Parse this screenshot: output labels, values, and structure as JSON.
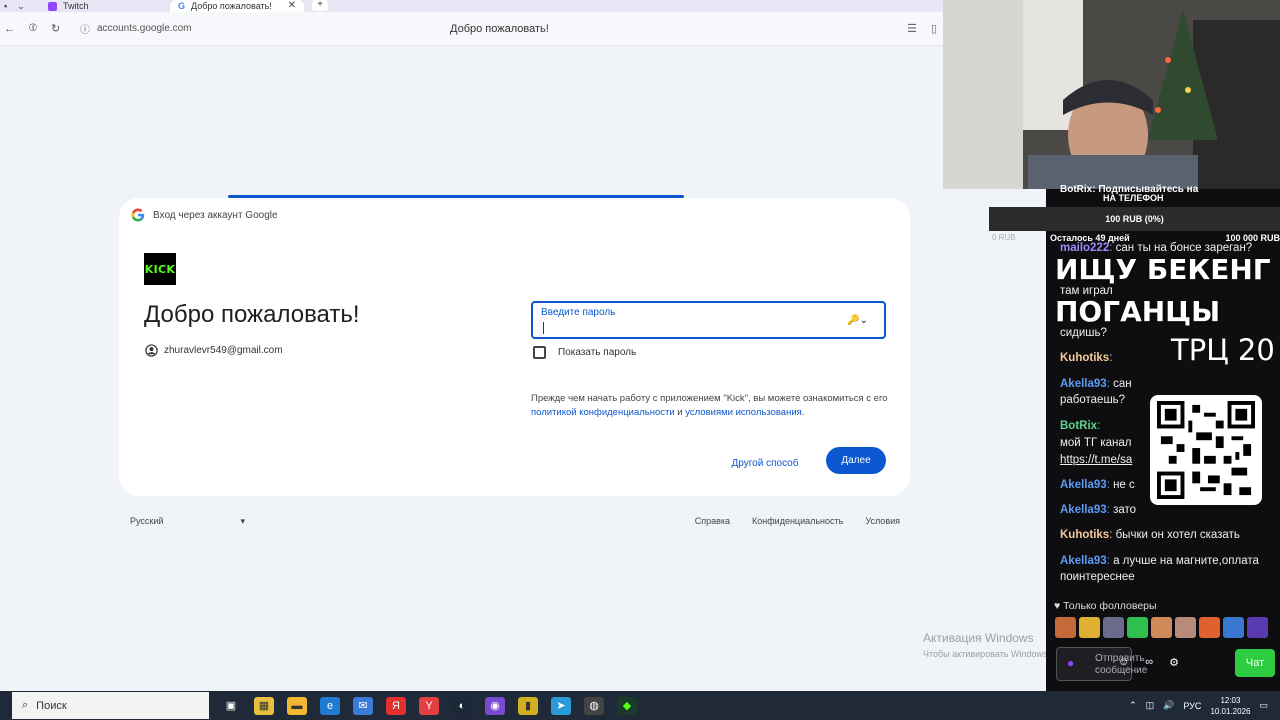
{
  "browser": {
    "tabs": [
      {
        "label": "Twitch",
        "active": false
      },
      {
        "label": "Добро пожаловать!",
        "active": true
      }
    ],
    "new_tab": "+",
    "url": "accounts.google.com",
    "page_title": "Добро пожаловать!"
  },
  "signin": {
    "header": "Вход через аккаунт Google",
    "app_logo_text": "KICK",
    "welcome": "Добро пожаловать!",
    "email": "zhuravlevr549@gmail.com",
    "password_label": "Введите пароль",
    "show_password": "Показать пароль",
    "disclaimer_prefix": "Прежде чем начать работу с приложением \"Kick\", вы можете ознакомиться с его ",
    "privacy_link": "политикой конфиденциальности",
    "conjunction": " и ",
    "terms_link": "условиями использования",
    "period": ".",
    "other_way": "Другой способ",
    "next": "Далее"
  },
  "footer": {
    "language": "Русский",
    "links": [
      "Справка",
      "Конфиденциальность",
      "Условия"
    ]
  },
  "activation": {
    "line1": "Активация Windows",
    "line2": "Чтобы активировать Windows, перейдите в раздел \"Параметры\"."
  },
  "overlay": {
    "top_text": "BotRix: Подписывайтесь на",
    "phone_text": "НА ТЕЛЕФОН",
    "donation": "100 RUB (0%)",
    "donation_left": "0 RUB",
    "donation_days": "Осталось 49 дней",
    "donation_goal": "100 000 RUB",
    "big_line1": "ИЩУ БЕКЕНГ",
    "big_line2": "ПОГАНЦЫ",
    "trc": "ТРЦ 20"
  },
  "chat": {
    "messages": [
      {
        "user": "mailo222",
        "text": "сан ты на бонсе зареган?",
        "color": "#9c8cff"
      },
      {
        "user": "",
        "text": "там играл",
        "color": "#ffffff"
      },
      {
        "user": "",
        "text": "сидишь?",
        "color": "#ffffff"
      },
      {
        "user": "Kuhotiks",
        "text": "",
        "color": "#f5c99b"
      },
      {
        "user": "Akella93",
        "text": "сан",
        "color": "#5c9cf5"
      },
      {
        "user": "",
        "text": "работаешь?",
        "color": "#ffffff"
      },
      {
        "user": "BotRix",
        "text": "",
        "color": "#5fd38d"
      },
      {
        "user": "",
        "text": "мой ТГ канал",
        "color": "#ffffff"
      },
      {
        "user": "",
        "text": "https://t.me/sa",
        "color": "#ffffff"
      },
      {
        "user": "Akella93",
        "text": "не с",
        "color": "#5c9cf5"
      },
      {
        "user": "Akella93",
        "text": "зато",
        "color": "#5c9cf5"
      },
      {
        "user": "Kuhotiks",
        "text": "бычки он хотел сказать",
        "color": "#f5c99b"
      },
      {
        "user": "Akella93",
        "text": "а лучше на магните,оплата поинтереснее",
        "color": "#5c9cf5"
      }
    ],
    "followers_only": "Только фолловеры",
    "send_placeholder": "Отправить сообщение",
    "chat_button": "Чат"
  },
  "taskbar": {
    "search": "Поиск",
    "lang": "РУС",
    "time": "12:03",
    "date": "10.01.2026"
  }
}
